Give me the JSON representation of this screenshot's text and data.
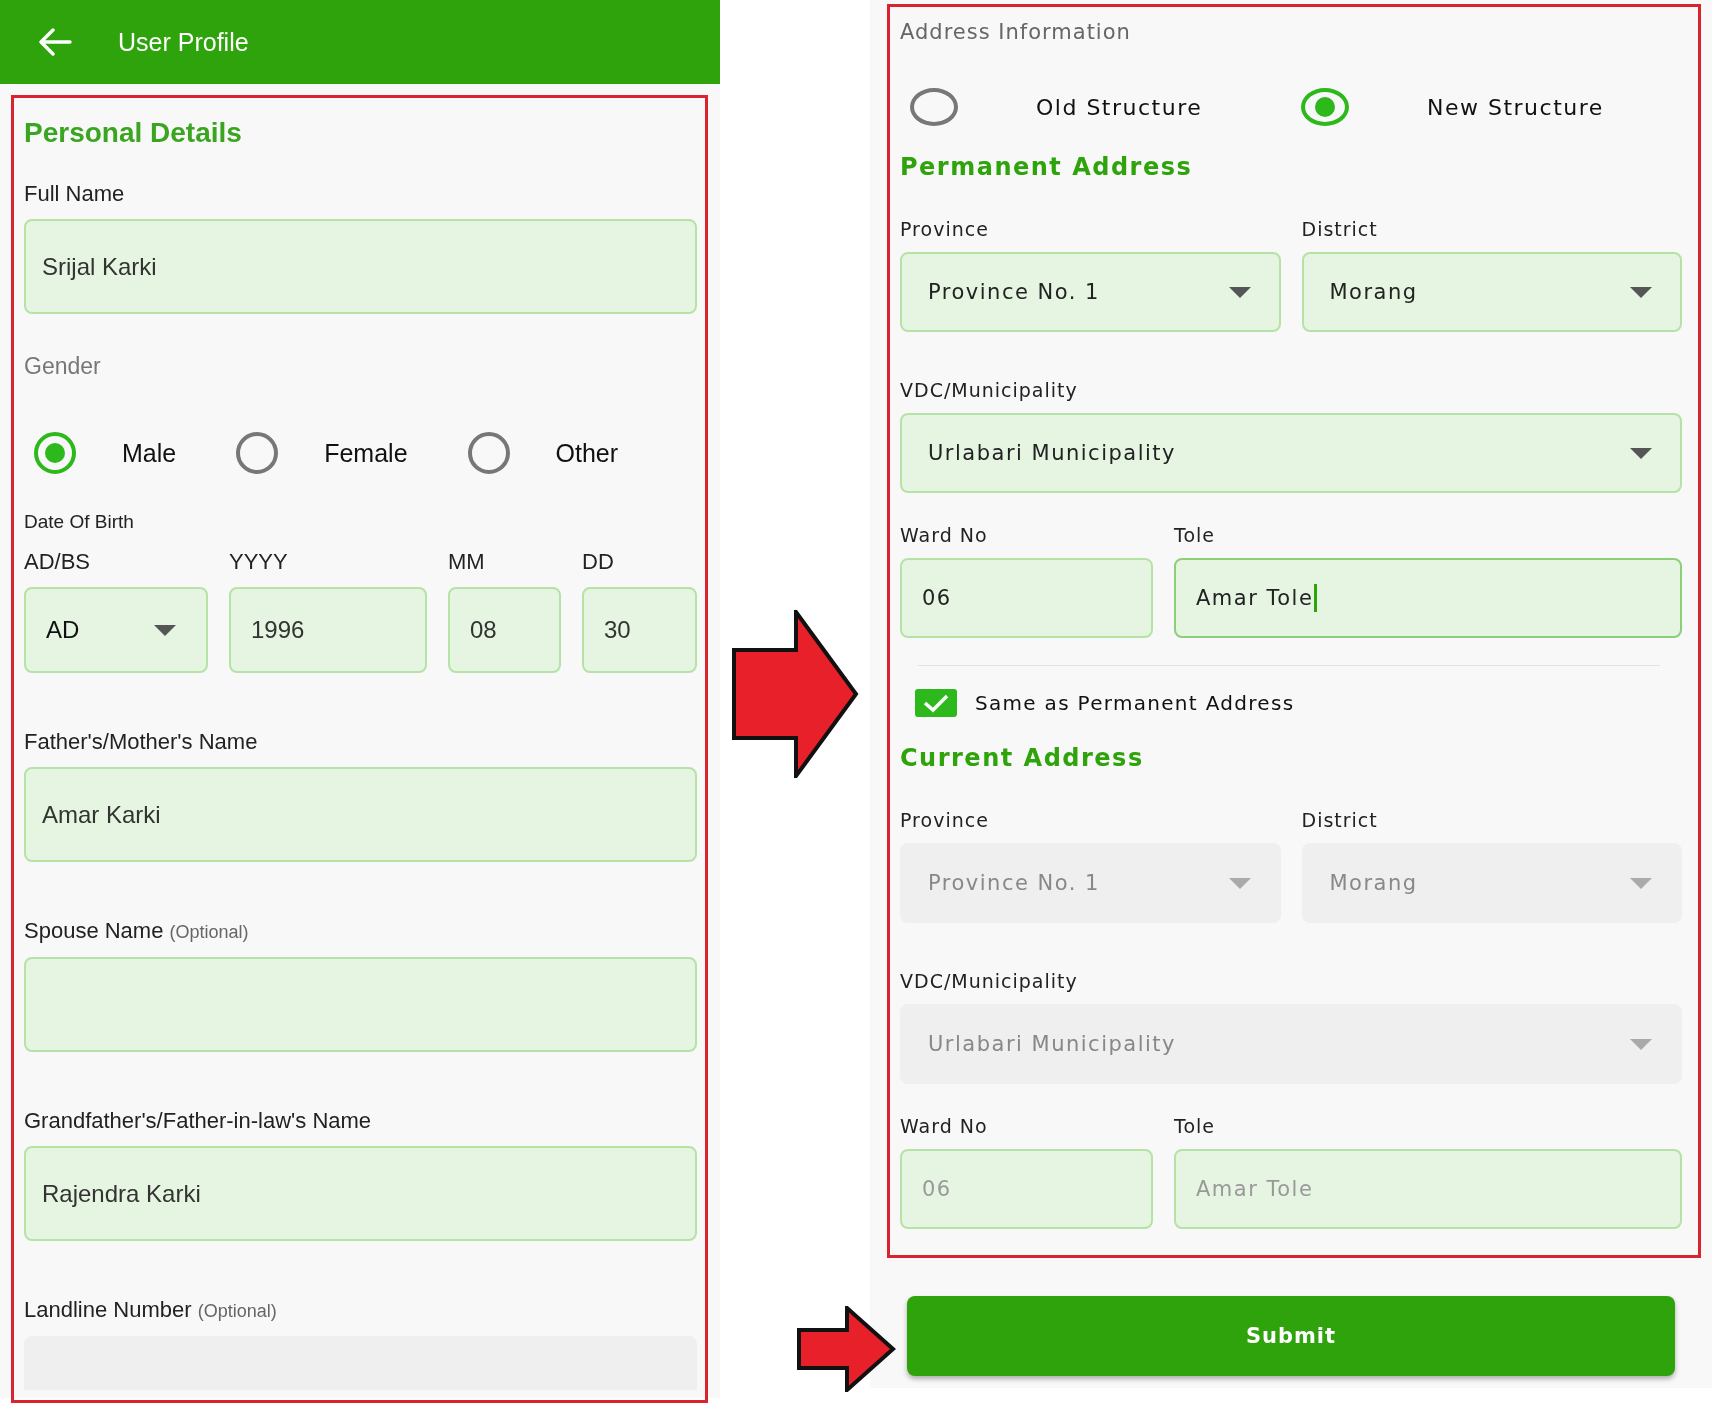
{
  "app_bar": {
    "title": "User Profile"
  },
  "personal_details": {
    "heading": "Personal Details",
    "items": [
      {
        "kind": "text",
        "label": "Full Name",
        "value": "Srijal Karki",
        "disabled": false
      },
      {
        "kind": "radio",
        "label": "Gender",
        "options": [
          {
            "label": "Male",
            "selected": true
          },
          {
            "label": "Female",
            "selected": false
          },
          {
            "label": "Other",
            "selected": false
          }
        ]
      },
      {
        "kind": "date",
        "label": "Date Of Birth",
        "parts": [
          {
            "kind": "dropdown",
            "label": "AD/BS",
            "value": "AD"
          },
          {
            "kind": "text",
            "label": "YYYY",
            "value": "1996"
          },
          {
            "kind": "text",
            "label": "MM",
            "value": "08"
          },
          {
            "kind": "text",
            "label": "DD",
            "value": "30"
          }
        ]
      },
      {
        "kind": "text",
        "label": "Father's/Mother's Name",
        "value": "Amar Karki",
        "disabled": false
      },
      {
        "kind": "text",
        "label": "Spouse Name",
        "note": "(Optional)",
        "disabled": false
      },
      {
        "kind": "text",
        "label": "Grandfather's/Father-in-law's Name",
        "value": "Rajendra Karki",
        "disabled": false
      },
      {
        "kind": "text",
        "label": "Landline Number",
        "note": "(Optional)",
        "disabled": true
      }
    ]
  },
  "address_information": {
    "heading": "Address Information",
    "structure_options": [
      {
        "label": "Old Structure",
        "selected": false
      },
      {
        "label": "New Structure",
        "selected": true
      }
    ],
    "sections": [
      {
        "kind": "address",
        "heading": "Permanent Address",
        "rows": [
          [
            {
              "kind": "dropdown",
              "label": "Province",
              "value": "Province No. 1",
              "disabled": false
            },
            {
              "kind": "dropdown",
              "label": "District",
              "value": "Morang",
              "disabled": false
            }
          ],
          [
            {
              "kind": "dropdown",
              "label": "VDC/Municipality",
              "value": "Urlabari Municipality",
              "disabled": false
            }
          ],
          [
            {
              "kind": "text",
              "label": "Ward No",
              "value": "06",
              "disabled": false,
              "focused": false
            },
            {
              "kind": "text",
              "label": "Tole",
              "value": "Amar Tole",
              "disabled": false,
              "focused": true
            }
          ]
        ]
      },
      {
        "kind": "checkbox",
        "label": "Same as Permanent Address",
        "checked": true
      },
      {
        "kind": "address",
        "heading": "Current Address",
        "rows": [
          [
            {
              "kind": "dropdown",
              "label": "Province",
              "value": "Province No. 1",
              "disabled": true
            },
            {
              "kind": "dropdown",
              "label": "District",
              "value": "Morang",
              "disabled": true
            }
          ],
          [
            {
              "kind": "dropdown",
              "label": "VDC/Municipality",
              "value": "Urlabari Municipality",
              "disabled": true
            }
          ],
          [
            {
              "kind": "text",
              "label": "Ward No",
              "value": "06",
              "disabled": true,
              "focused": false
            },
            {
              "kind": "text",
              "label": "Tole",
              "value": "Amar Tole",
              "disabled": true,
              "focused": false
            }
          ]
        ]
      }
    ]
  },
  "submit_button": {
    "label": "Submit"
  }
}
